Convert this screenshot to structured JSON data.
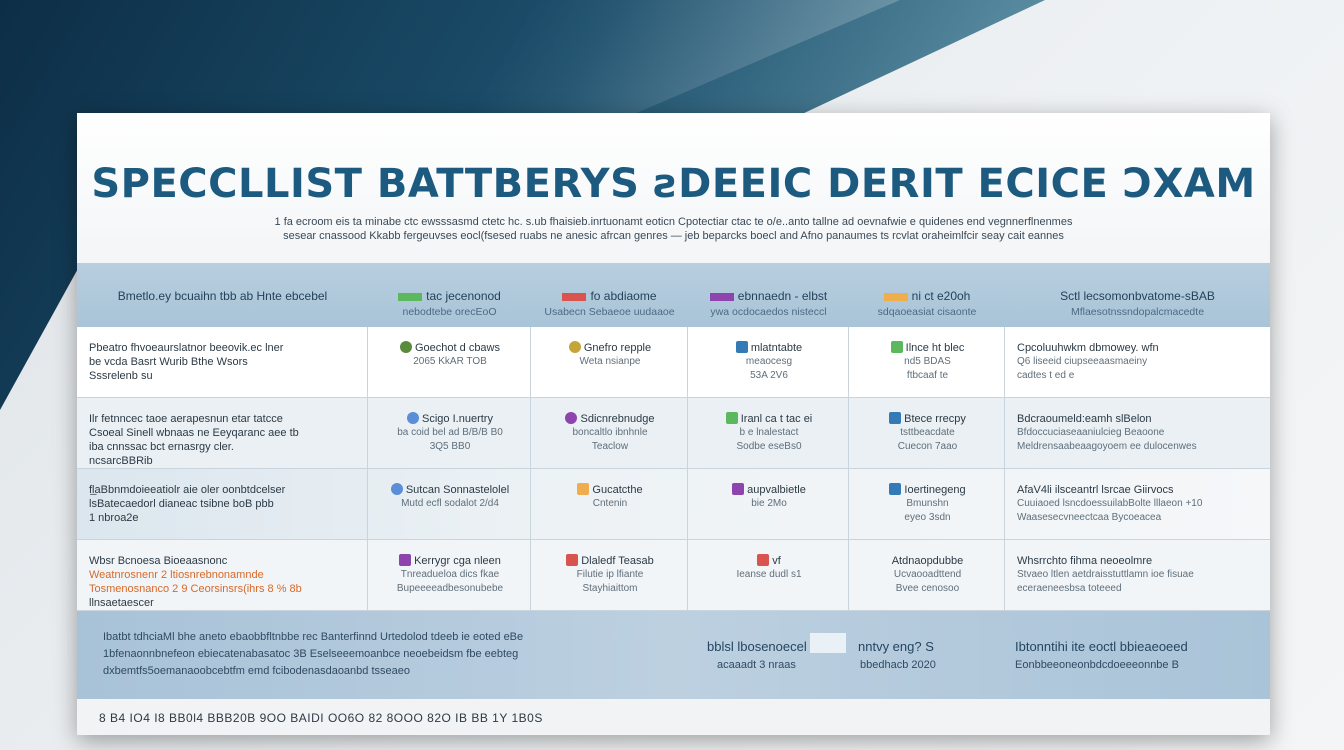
{
  "colors": {
    "title": "#1c5a80",
    "header_band": "#b7cede",
    "footer_band": "#a8c2d8",
    "accent_green": "#5cb85c",
    "accent_red": "#d9534f",
    "accent_purple": "#8e44ad",
    "accent_orange": "#f0ad4e",
    "accent_blue": "#337ab7"
  },
  "document": {
    "title": "SPECCLLIST BATTBERYS ƨDEEIC DERIT ECICE ƆXAM",
    "subtitle_line1": "1 fa ecroom eis ta minabe ctc ewsssasmd ctetc hc. s.ub fhaisieb.inrtuonamt eoticn  Cpotectiar ctac te o/e..anto tallne ad oevnafwie e quidenes end vegnnerflnenmes",
    "subtitle_line2": "sesear cnassood Kkabb fergeuvses eocl(fsesed ruabs ne anesic afrcan genres — jeb beparcks boecl and Afno panaumes ts rcvlat oraheimlfcir seay cait eannes"
  },
  "columns": [
    {
      "label": "Bmetlo.ey bcuaihn tbb ab Hnte  ebcebel",
      "sub": "",
      "swatch": "",
      "swatch_name": ""
    },
    {
      "label": "tac jecenonod",
      "sub": "nebodtebe  orecEoO",
      "swatch": "#5cb85c",
      "swatch_name": "green-swatch-icon"
    },
    {
      "label": "fo abdiaome",
      "sub": "Usabecn Sebaeoe uudaaoe",
      "swatch": "#d9534f",
      "swatch_name": "red-swatch-icon"
    },
    {
      "label": "ebnnaedn - elbst",
      "sub": "ywa ocdocaedos nisteccl",
      "swatch": "#8e44ad",
      "swatch_name": "purple-swatch-icon"
    },
    {
      "label": "ni ct e20oh",
      "sub": "sdqaoeasiat cisaonte",
      "swatch": "#f0ad4e",
      "swatch_name": "orange-swatch-icon"
    },
    {
      "label": "Sctl lecsomonbvatome-sBAB",
      "sub": "Mflaesotnssndopalcmacedte",
      "swatch": "",
      "swatch_name": ""
    }
  ],
  "rows": [
    {
      "c0": [
        "Pbeatro fhvoeaurslatnor beeovik.ec lner",
        "be vcda Basrt Wurib Bthe Wsors",
        "Sssrelenb su"
      ],
      "c0_colors": [
        "",
        "",
        ""
      ],
      "c1": [
        "Goechot d cbaws",
        "2065 KkAR TOB"
      ],
      "c1_icon": "#5a8a3c",
      "c1_icon_name": "green-dot-icon",
      "c2": [
        "Gnefro repple",
        "Weta nsianpe"
      ],
      "c2_icon": "#c5a53a",
      "c2_icon_name": "yellow-dot-icon",
      "c3": [
        "mlatntabte",
        "meaocesg",
        "53A 2V6"
      ],
      "c3_icon": "#337ab7",
      "c3_icon_name": "blue-flag-icon",
      "c4": [
        "Ilnce ht blec",
        "nd5 BDAS",
        "ftbcaaf te"
      ],
      "c4_icon": "#5cb85c",
      "c4_icon_name": "green-flag-icon",
      "c5": [
        "Cpcoluuhwkm dbmowey. wfn",
        "Q6 liseeid ciupseeaasmaeiny",
        "cadtes t ed e"
      ]
    },
    {
      "c0": [
        "Ilr fetnncec taoe  aerapesnun etar tatcce",
        "Csoeal Sinell wbnaas ne Eeyqaranc aee tb",
        "iba cnnssac bct ernasrgy cler.",
        "ncsarcBBRib"
      ],
      "c0_colors": [
        "",
        "",
        "",
        ""
      ],
      "c1": [
        "Scigo I.nuertry",
        "ba coid bel ad B/B/B  B0",
        "3Q5 BB0"
      ],
      "c1_icon": "#5b8dd8",
      "c1_icon_name": "blue-dot-icon",
      "c2": [
        "Sdicnrebnudge",
        "boncaltlo ibnhnle",
        "Teaclow"
      ],
      "c2_icon": "#8e44ad",
      "c2_icon_name": "purple-dot-icon",
      "c3": [
        "Iranl ca t tac ei",
        "b e lnalestact",
        "Sodbe eseBs0"
      ],
      "c3_icon": "#5cb85c",
      "c3_icon_name": "green-square-icon",
      "c4": [
        "Btece rrecpy",
        "tsttbeacdate",
        "Cuecon 7aao"
      ],
      "c4_icon": "#337ab7",
      "c4_icon_name": "blue-square-icon",
      "c5": [
        "Bdcraoumeld:eamh  slBelon",
        "Bfdoccuciaseaaniulcieg Beaoone",
        "Meldrensaabeaagoyoem ee dulocenwes"
      ]
    },
    {
      "c0": [
        "fl̲aBbnmdoieeatiolr aie oler oonbtdcelser",
        "lsBatecaedorl dianeac tsibne boB pbb",
        "1 nbroa2e"
      ],
      "c0_colors": [
        "",
        "",
        ""
      ],
      "c1": [
        "Sutcan Sonnastelolel",
        "Mutd ecfl sodalot 2/d4"
      ],
      "c1_icon": "#5b8dd8",
      "c1_icon_name": "blue-dot-icon",
      "c2": [
        "Gucatcthe",
        "Cntenin"
      ],
      "c2_icon": "#f0ad4e",
      "c2_icon_name": "orange-box-icon",
      "c3": [
        "aupvalbietle",
        "bie 2Mo"
      ],
      "c3_icon": "#8e44ad",
      "c3_icon_name": "purple-flag-icon",
      "c4": [
        "Ioertinegeng",
        "Bmunshn",
        "eyeo 3sdn"
      ],
      "c4_icon": "#337ab7",
      "c4_icon_name": "blue-flag-icon",
      "c5": [
        "AfaV4li ilsceantrl lsrcae Giirvocs",
        "Cuuiaoed lsncdoessuilabBolte lllaeon +10",
        "Waasesecvneectcaa  Bycoeacea"
      ]
    },
    {
      "c0": [
        "Wbsr Bcnoesa Bioeaasnonc",
        "Weatnrosnenr 2 ltiosnrebnonamnde",
        "Tosmenosnanco 2 9 Ceorsinsrs(ihrs 8 % 8b",
        "llnsaetaescer"
      ],
      "c0_colors": [
        "",
        "orange",
        "orange",
        ""
      ],
      "c1": [
        "Kerrygr cga nleen",
        "Tnreadueloa dics fkae",
        "Bupeeeeadbesonubebe"
      ],
      "c1_icon": "#8e44ad",
      "c1_icon_name": "purple-square-icon",
      "c2": [
        "Dlaledf Teasab",
        "Filutie ip lfiante",
        "Stayhiaittom"
      ],
      "c2_icon": "#d9534f",
      "c2_icon_name": "red-square-icon",
      "c3": [
        "vf",
        "Ieanse dudl s1"
      ],
      "c3_icon": "#d9534f",
      "c3_icon_name": "multicolor-chart-icon",
      "c4": [
        "Atdnaopdubbe",
        "Ucvaooadttend",
        "Bvee cenosoo"
      ],
      "c4_icon": "",
      "c4_icon_name": "",
      "c5": [
        "Whsrrchto fihma neoeolmre",
        "Stvaeo ltlen aetdraisstuttlamn ioe fisuae",
        "eceraeneesbsa toteeed"
      ]
    }
  ],
  "footer_band": {
    "left_line1": "Ibatbt tdhciaMl bhe aneto ebaobbfltnbbe rec Banterfinnd Urtedolod tdeeb ie eoted eBe",
    "left_line2": "1bfenaonnbnefeon ebiecatenabasatoc 3B Eselseeemoanbce neoebeidsm fbe eebteg",
    "left_line3": "dxbemtfs5oemanaoobcebtfm emd fcibodenasdaoanbd tsseaeo",
    "mid_main": "bblsl lbosenoecel",
    "mid_q": "nntvy eng? S",
    "mid_sub": "acaaadt 3 nraas",
    "mid_sub2": "bbedhacb 2020",
    "right_main": "Ibtonntihi ite eoctl  bbieaeoeed",
    "right_sub": "Eonbbeeoneonbdcdoeeeonnbe B"
  },
  "bottom_bar": {
    "text": "8 B4  IO4  I8 BB0l4  BBB20B  9OO BAIDI  OO6O  82  8OOO 82O  IB BB 1Y  1B0S"
  }
}
